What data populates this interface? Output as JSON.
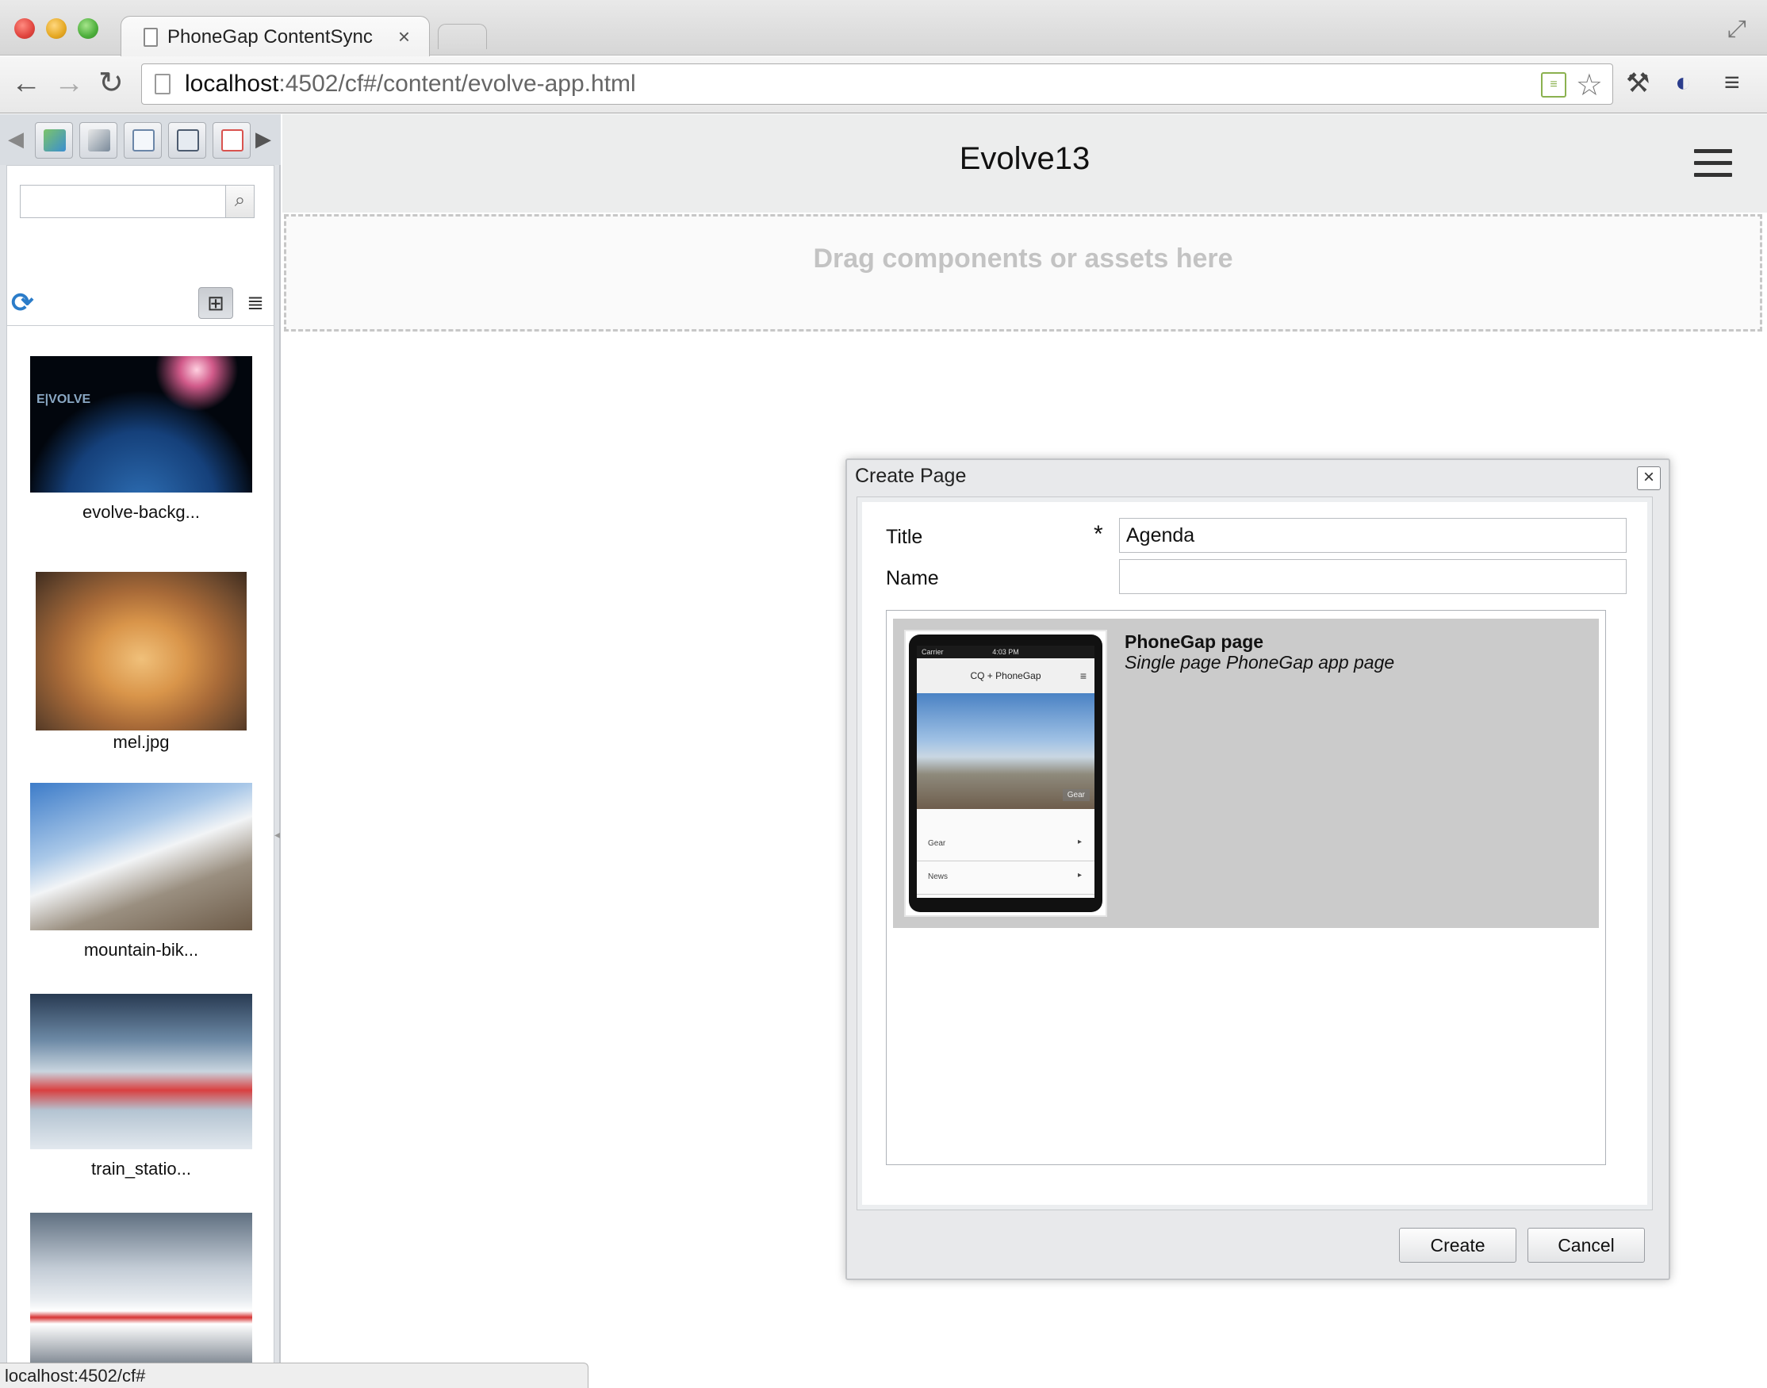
{
  "browser": {
    "tab_title": "PhoneGap ContentSync",
    "tab_close": "×",
    "url_host": "localhost",
    "url_path": ":4502/cf#/content/evolve-app.html",
    "back": "←",
    "forward": "→",
    "reload": "↻",
    "star": "☆",
    "wrench": "🔧",
    "menu": "≡",
    "fullscreen": "⤢"
  },
  "sidebar": {
    "icons": [
      "images-tab-icon",
      "documents-tab-icon",
      "pages-tab-icon",
      "movies-tab-icon",
      "flash-tab-icon"
    ],
    "search_placeholder": "",
    "search_button": "⌕",
    "refresh": "⟳",
    "grid_view": "⊞",
    "list_view": "≣",
    "assets": [
      {
        "caption": "evolve-backg...",
        "thumb_text": "E|VOLVE"
      },
      {
        "caption": "mel.jpg"
      },
      {
        "caption": "mountain-bik..."
      },
      {
        "caption": "train_statio..."
      },
      {
        "caption": ""
      }
    ]
  },
  "app": {
    "title": "Evolve13",
    "dropzone": "Drag components or assets here"
  },
  "dialog": {
    "title": "Create Page",
    "close": "×",
    "title_label": "Title",
    "required_mark": "*",
    "title_value": "Agenda",
    "name_label": "Name",
    "name_value": "",
    "template": {
      "name": "PhoneGap page",
      "description": "Single page PhoneGap app page",
      "preview": {
        "carrier": "Carrier",
        "time": "4:03 PM",
        "header": "CQ + PhoneGap",
        "gear_badge": "Gear",
        "rows": [
          "Gear",
          "News"
        ]
      }
    },
    "create": "Create",
    "cancel": "Cancel"
  },
  "statusbar": {
    "text": "localhost:4502/cf#"
  },
  "colors": {
    "dialog_bg": "#e8e9eb",
    "template_selected": "#cbcbcb",
    "refresh_icon": "#2b7cc9"
  }
}
